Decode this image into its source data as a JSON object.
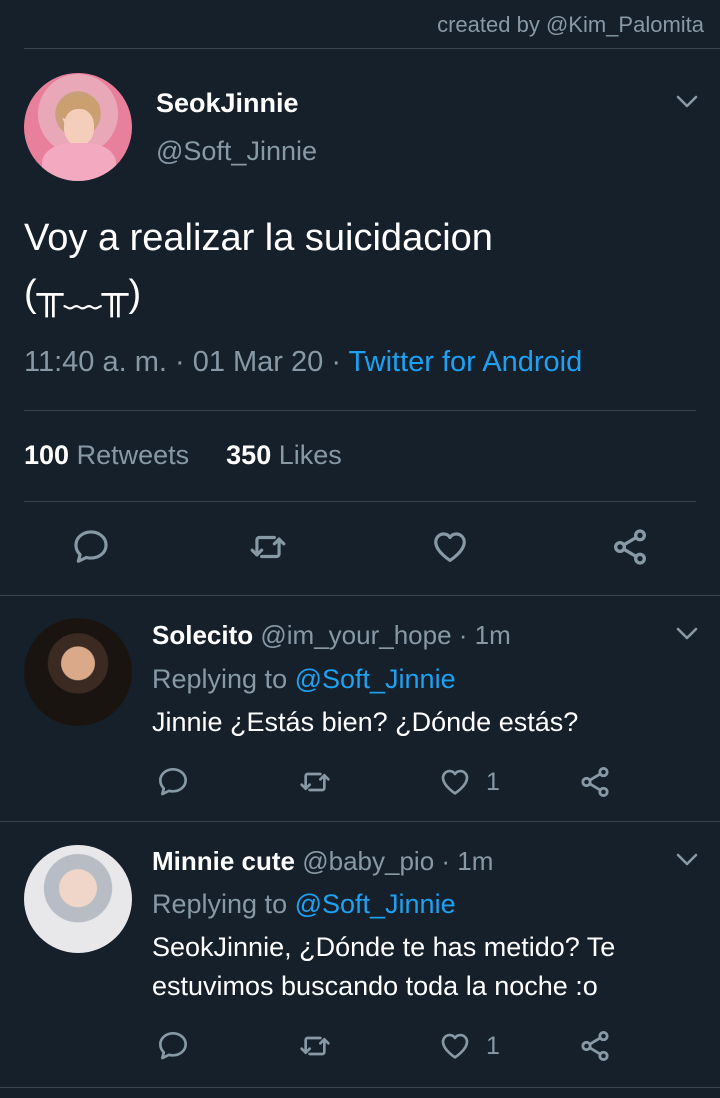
{
  "credit": "created by @Kim_Palomita",
  "main_tweet": {
    "name": "SeokJinnie",
    "handle": "@Soft_Jinnie",
    "text_line1": "Voy a realizar la suicidacion",
    "text_line2": "(╥﹏╥)",
    "time": "11:40 a. m. · 01 Mar 20 · ",
    "source": "Twitter for Android",
    "retweets_count": "100",
    "retweets_label": " Retweets",
    "likes_count": "350",
    "likes_label": " Likes"
  },
  "replies": [
    {
      "name": "Solecito",
      "handle": " @im_your_hope · 1m",
      "replying_prefix": "Replying to ",
      "replying_to": "@Soft_Jinnie",
      "text": "Jinnie ¿Estás bien? ¿Dónde estás?",
      "like_count": "1"
    },
    {
      "name": "Minnie cute",
      "handle": " @baby_pio · 1m",
      "replying_prefix": "Replying to ",
      "replying_to": "@Soft_Jinnie",
      "text": "SeokJinnie, ¿Dónde te has metido? Te estuvimos buscando toda la noche :o",
      "like_count": "1"
    }
  ],
  "colors": {
    "background": "#15202b",
    "secondary_text": "#8899a6",
    "accent": "#1da1f2",
    "divider": "#38444d"
  },
  "icons": [
    "chevron-down-icon",
    "reply-icon",
    "retweet-icon",
    "like-icon",
    "share-icon"
  ]
}
